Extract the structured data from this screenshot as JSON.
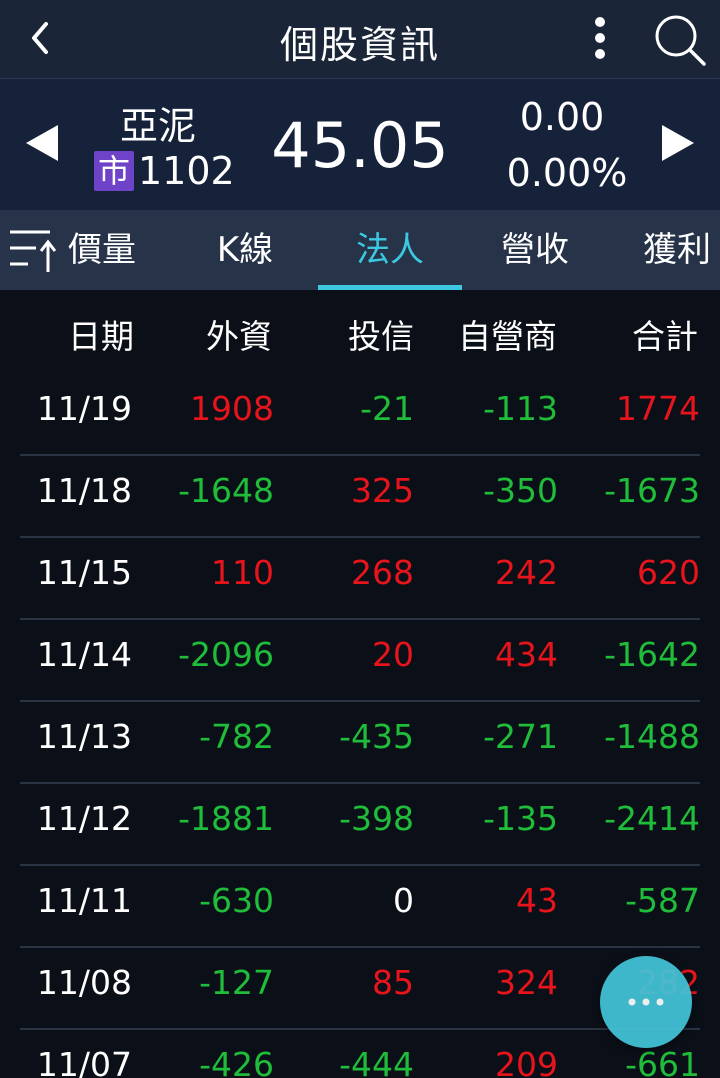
{
  "header": {
    "title": "個股資訊",
    "back_icon": "chevron-left-icon",
    "more_icon": "more-vertical-icon",
    "search_icon": "search-icon"
  },
  "quote": {
    "name": "亞泥",
    "market_badge": "市",
    "code": "1102",
    "price": "45.05",
    "change": "0.00",
    "change_pct": "0.00%"
  },
  "tabs": [
    {
      "label": "價量"
    },
    {
      "label": "K線"
    },
    {
      "label": "法人"
    },
    {
      "label": "營收"
    },
    {
      "label": "獲利"
    }
  ],
  "active_tab": "法人",
  "table": {
    "headers": [
      "日期",
      "外資",
      "投信",
      "自營商",
      "合計"
    ],
    "rows": [
      {
        "date": "11/19",
        "foreign": "1908",
        "trust": "-21",
        "dealer": "-113",
        "total": "1774"
      },
      {
        "date": "11/18",
        "foreign": "-1648",
        "trust": "325",
        "dealer": "-350",
        "total": "-1673"
      },
      {
        "date": "11/15",
        "foreign": "110",
        "trust": "268",
        "dealer": "242",
        "total": "620"
      },
      {
        "date": "11/14",
        "foreign": "-2096",
        "trust": "20",
        "dealer": "434",
        "total": "-1642"
      },
      {
        "date": "11/13",
        "foreign": "-782",
        "trust": "-435",
        "dealer": "-271",
        "total": "-1488"
      },
      {
        "date": "11/12",
        "foreign": "-1881",
        "trust": "-398",
        "dealer": "-135",
        "total": "-2414"
      },
      {
        "date": "11/11",
        "foreign": "-630",
        "trust": "0",
        "dealer": "43",
        "total": "-587"
      },
      {
        "date": "11/08",
        "foreign": "-127",
        "trust": "85",
        "dealer": "324",
        "total": "282"
      },
      {
        "date": "11/07",
        "foreign": "-426",
        "trust": "-444",
        "dealer": "209",
        "total": "-661"
      }
    ]
  },
  "fab_icon": "more-horizontal-icon",
  "colors": {
    "accent": "#3cc8e0",
    "positive": "#e8141c",
    "negative": "#1fbd3a",
    "badge": "#6f43c8"
  }
}
